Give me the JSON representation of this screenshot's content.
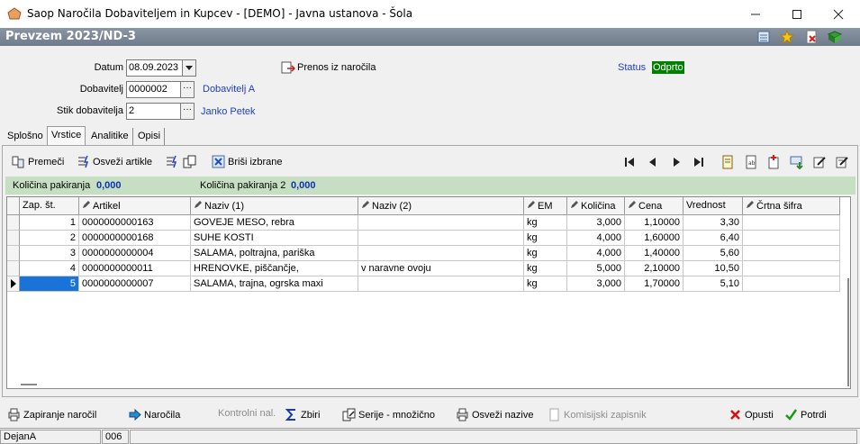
{
  "window": {
    "title": "Saop   Naročila Dobaviteljem in Kupcev  - [DEMO] - Javna ustanova - Šola"
  },
  "header": {
    "doc_title": "Prevzem 2023/ND-3"
  },
  "form": {
    "datum_label": "Datum",
    "datum_value": "08.09.2023",
    "dobavitelj_label": "Dobavitelj",
    "dobavitelj_value": "0000002",
    "dobavitelj_name": "Dobavitelj A",
    "stik_label": "Stik dobavitelja",
    "stik_value": "2",
    "stik_name": "Janko Petek",
    "prenos_label": "Prenos iz naročila",
    "status_label": "Status",
    "status_value": "Odprto",
    "status_color": "#008000"
  },
  "tabs": [
    "Splošno",
    "Vrstice",
    "Analitike",
    "Opisi"
  ],
  "toolbar": {
    "premeci": "Premeči",
    "osvezi_artikle": "Osveži artikle",
    "brisi_izbrane": "Briši izbrane"
  },
  "qty": {
    "kolicina_pakiranja_label": "Količina pakiranja",
    "kolicina_pakiranja_value": "0,000",
    "kolicina_pakiranja2_label": "Količina pakiranja 2",
    "kolicina_pakiranja2_value": "0,000"
  },
  "grid": {
    "columns": [
      "Zap. št.",
      "Artikel",
      "Naziv (1)",
      "Naziv (2)",
      "EM",
      "Količina",
      "Cena",
      "Vrednost",
      "Črtna šifra"
    ],
    "rows": [
      [
        "1",
        "0000000000163",
        "GOVEJE MESO, rebra",
        "",
        "kg",
        "3,000",
        "1,10000",
        "3,30",
        ""
      ],
      [
        "2",
        "0000000000168",
        "SUHE KOSTI",
        "",
        "kg",
        "4,000",
        "1,60000",
        "6,40",
        ""
      ],
      [
        "3",
        "0000000000004",
        "SALAMA, poltrajna, pariška",
        "",
        "kg",
        "4,000",
        "1,40000",
        "5,60",
        ""
      ],
      [
        "4",
        "0000000000011",
        "HRENOVKE, piščančje,",
        "v naravne ovoju",
        "kg",
        "5,000",
        "2,10000",
        "10,50",
        ""
      ],
      [
        "5",
        "0000000000007",
        "SALAMA, trajna, ogrska  maxi",
        "",
        "kg",
        "3,000",
        "1,70000",
        "5,10",
        ""
      ]
    ]
  },
  "bottom": {
    "zapiranje": "Zapiranje naročil",
    "narocila": "Naročila",
    "kontrolni": "Kontrolni nal.",
    "zbiri": "Zbiri",
    "serije": "Serije - množično",
    "osvezi_nazive": "Osveži nazive",
    "komisijski": "Komisijski zapisnik",
    "opusti": "Opusti",
    "potrdi": "Potrdi"
  },
  "status": {
    "user": "DejanA",
    "code": "006"
  }
}
